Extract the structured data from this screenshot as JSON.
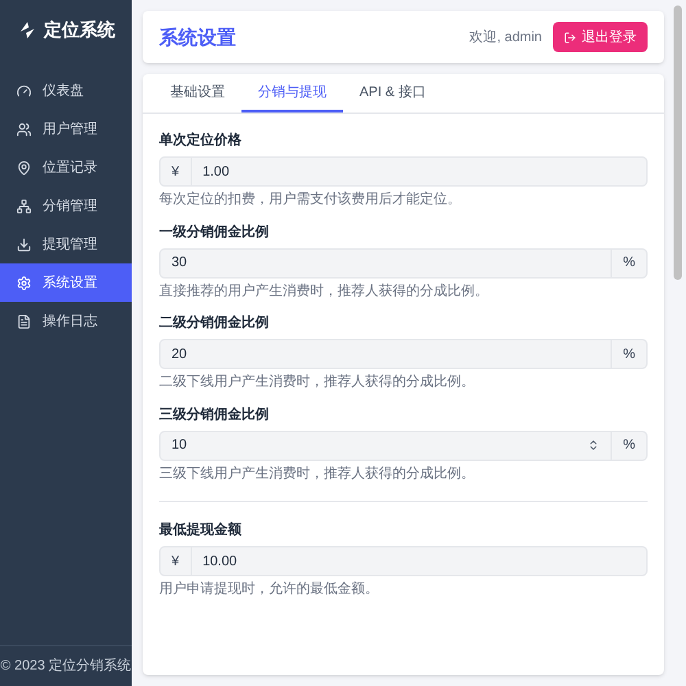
{
  "sidebar": {
    "logo": "定位系统",
    "items": [
      {
        "label": "仪表盘",
        "selected": false
      },
      {
        "label": "用户管理",
        "selected": false
      },
      {
        "label": "位置记录",
        "selected": false
      },
      {
        "label": "分销管理",
        "selected": false
      },
      {
        "label": "提现管理",
        "selected": false
      },
      {
        "label": "系统设置",
        "selected": true
      },
      {
        "label": "操作日志",
        "selected": false
      }
    ],
    "footer": "© 2023 定位分销系统"
  },
  "header": {
    "title": "系统设置",
    "welcome": "欢迎, admin",
    "logout": "退出登录"
  },
  "tabs": [
    {
      "label": "基础设置",
      "selected": false
    },
    {
      "label": "分销与提现",
      "selected": true
    },
    {
      "label": "API & 接口",
      "selected": false
    }
  ],
  "fields": [
    {
      "kind": "prefix",
      "label": "单次定位价格",
      "affix": "¥",
      "value": "1.00",
      "help": "每次定位的扣费，用户需支付该费用后才能定位。"
    },
    {
      "kind": "suffix",
      "label": "一级分销佣金比例",
      "affix": "%",
      "value": "30",
      "help": "直接推荐的用户产生消费时，推荐人获得的分成比例。"
    },
    {
      "kind": "suffix",
      "label": "二级分销佣金比例",
      "affix": "%",
      "value": "20",
      "help": "二级下线用户产生消费时，推荐人获得的分成比例。"
    },
    {
      "kind": "number",
      "label": "三级分销佣金比例",
      "affix": "%",
      "value": "10",
      "help": "三级下线用户产生消费时，推荐人获得的分成比例。"
    },
    {
      "kind": "divider"
    },
    {
      "kind": "prefix",
      "label": "最低提现金额",
      "affix": "¥",
      "value": "10.00",
      "help": "用户申请提现时，允许的最低金额。"
    }
  ]
}
